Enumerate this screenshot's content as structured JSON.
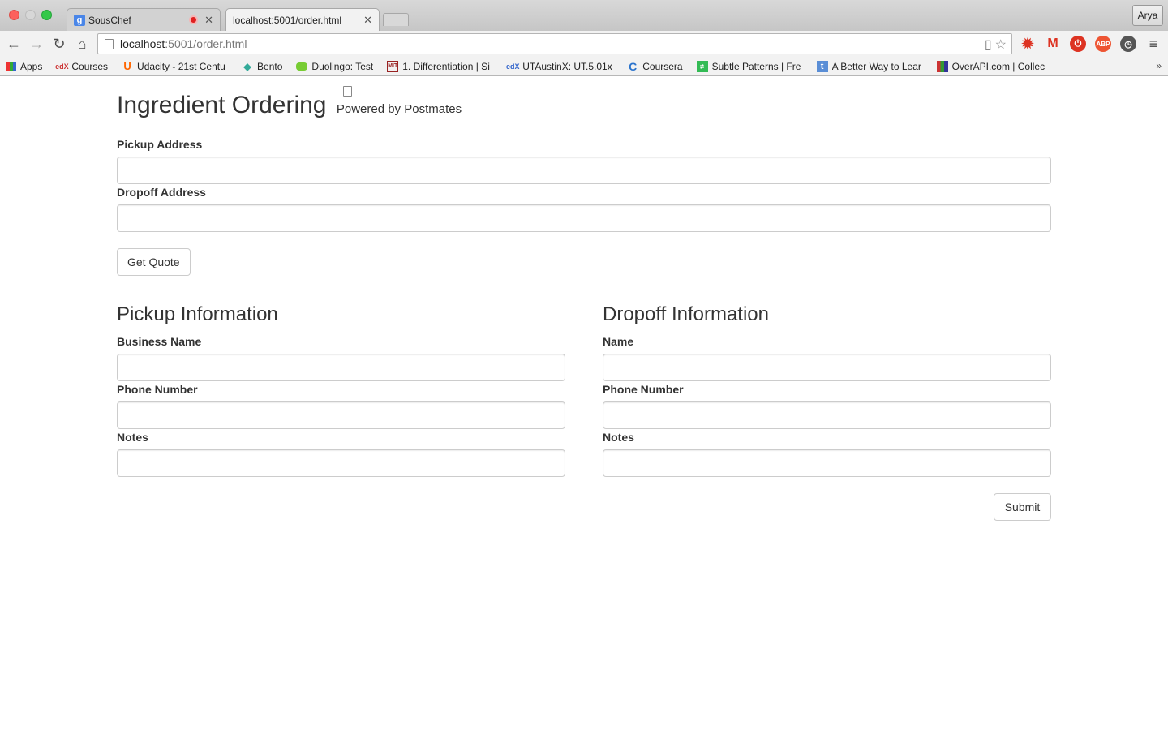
{
  "browser": {
    "tabs": [
      {
        "title": "SousChef",
        "active": false,
        "recording": true
      },
      {
        "title": "localhost:5001/order.html",
        "active": true,
        "recording": false
      }
    ],
    "profile_name": "Arya",
    "url": {
      "host": "localhost",
      "path": ":5001/order.html"
    },
    "bookmarks": [
      {
        "label": "Apps",
        "icon": "apps-grid-icon"
      },
      {
        "label": "Courses",
        "icon": "edx-icon"
      },
      {
        "label": "Udacity - 21st Centu",
        "icon": "udacity-icon"
      },
      {
        "label": "Bento",
        "icon": "bento-icon"
      },
      {
        "label": "Duolingo: Test",
        "icon": "duolingo-icon"
      },
      {
        "label": "1. Differentiation | Si",
        "icon": "mit-ocw-icon"
      },
      {
        "label": "UTAustinX: UT.5.01x",
        "icon": "edx-icon"
      },
      {
        "label": "Coursera",
        "icon": "coursera-icon"
      },
      {
        "label": "Subtle Patterns | Fre",
        "icon": "subtle-patterns-icon"
      },
      {
        "label": "A Better Way to Lear",
        "icon": "tumblr-icon"
      },
      {
        "label": "OverAPI.com | Collec",
        "icon": "overapi-icon"
      }
    ],
    "bookmarks_overflow": "»"
  },
  "page": {
    "title": "Ingredient Ordering",
    "subtitle": "Powered by Postmates",
    "pickup_address_label": "Pickup Address",
    "pickup_address_value": "",
    "dropoff_address_label": "Dropoff Address",
    "dropoff_address_value": "",
    "get_quote_label": "Get Quote",
    "pickup_section": {
      "heading": "Pickup Information",
      "business_name_label": "Business Name",
      "business_name_value": "",
      "phone_label": "Phone Number",
      "phone_value": "",
      "notes_label": "Notes",
      "notes_value": ""
    },
    "dropoff_section": {
      "heading": "Dropoff Information",
      "name_label": "Name",
      "name_value": "",
      "phone_label": "Phone Number",
      "phone_value": "",
      "notes_label": "Notes",
      "notes_value": ""
    },
    "submit_label": "Submit"
  }
}
